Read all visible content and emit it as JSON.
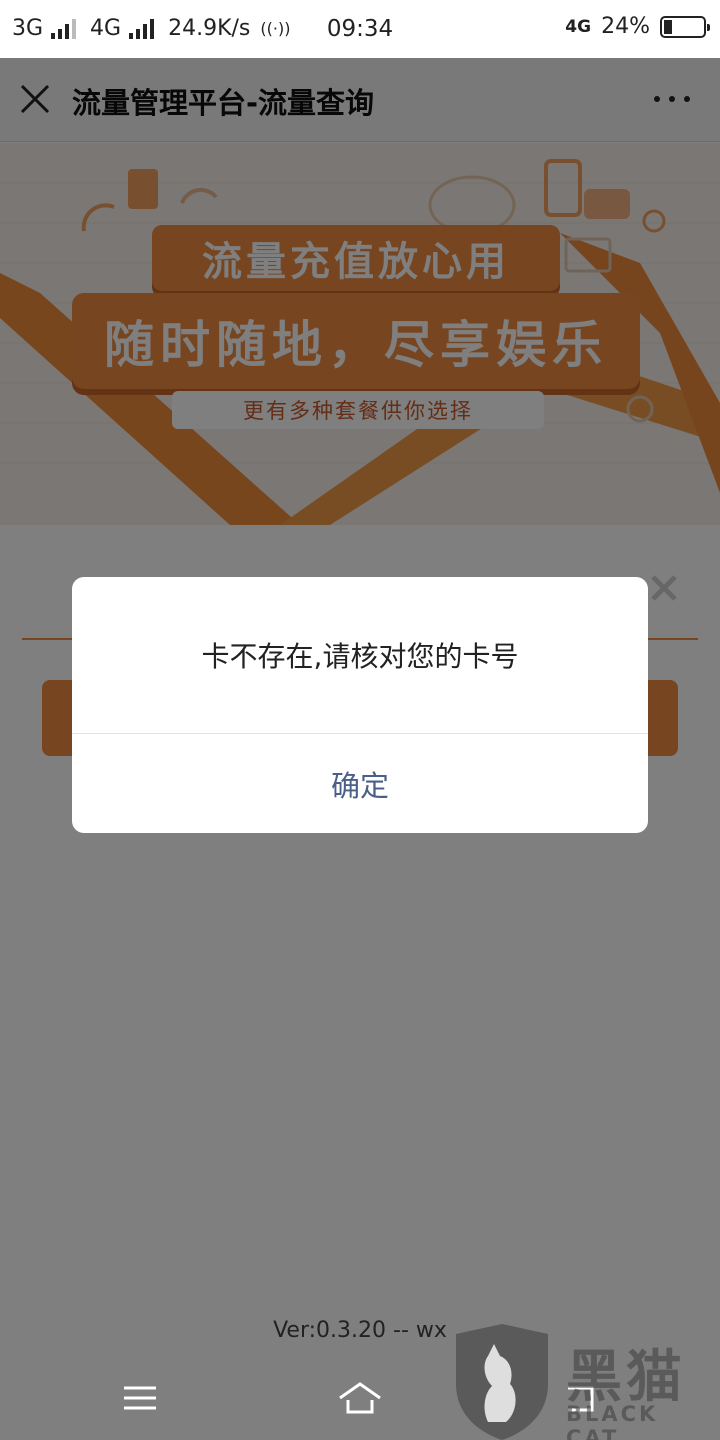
{
  "status_bar": {
    "network1": "3G",
    "network2": "4G",
    "speed": "24.9K/s",
    "time": "09:34",
    "volte": "4G",
    "battery": "24%",
    "battery_level": 0.24
  },
  "title_bar": {
    "title": "流量管理平台-流量查询",
    "close_icon": "close-icon",
    "more_icon": "more-icon"
  },
  "banner": {
    "slogan1": "流量充值放心用",
    "slogan2": "随时随地，尽享娱乐",
    "slogan3": "更有多种套餐供你选择"
  },
  "footer": {
    "version": "Ver:0.3.20 -- wx"
  },
  "dialog": {
    "message": "卡不存在,请核对您的卡号",
    "confirm": "确定"
  },
  "nav_bar": {
    "menu_icon": "menu-icon",
    "home_icon": "home-icon",
    "back_icon": "back-icon"
  },
  "watermark": {
    "cn": "黑猫",
    "en": "BLACK CAT"
  },
  "colors": {
    "accent": "#ee8a40",
    "dialog_button": "#4b6088",
    "overlay": "rgba(0,0,0,0.5)"
  }
}
